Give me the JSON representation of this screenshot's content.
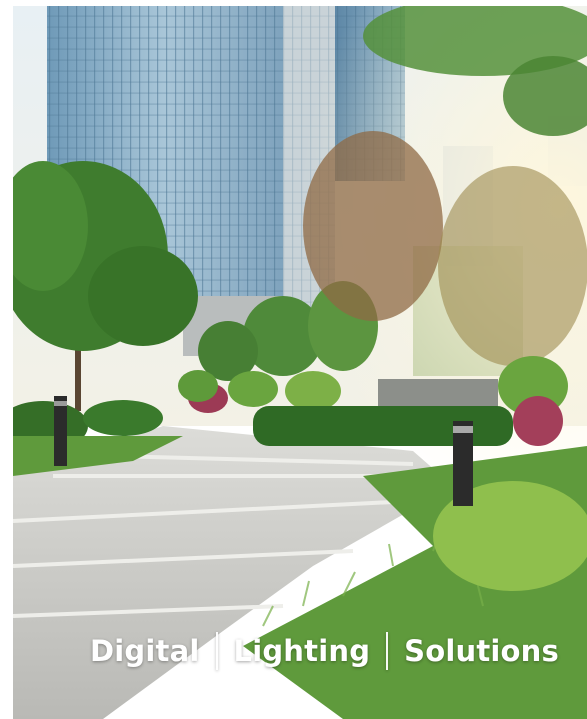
{
  "caption": {
    "words": [
      "Digital",
      "Lighting",
      "Solutions"
    ],
    "text_color": "#ffffff"
  },
  "colors": {
    "sky": "#e4eef2",
    "glass": "#7fa8c4",
    "foliage": "#3d7a2c",
    "paving": "#c9c8c4",
    "bollard": "#2b2b2b"
  }
}
